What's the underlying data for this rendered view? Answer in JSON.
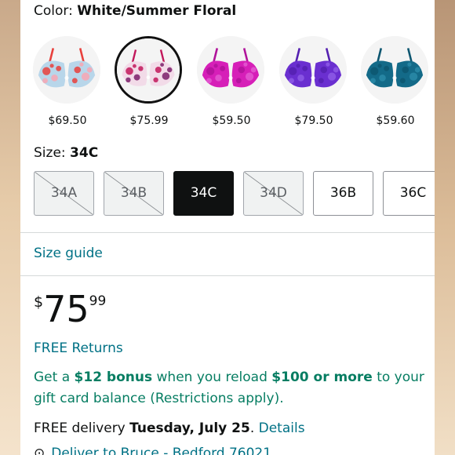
{
  "color": {
    "label": "Color:",
    "value": "White/Summer Floral"
  },
  "swatches": [
    {
      "price": "$69.50",
      "icon": "bra-light-blue-floral-icon",
      "cup": "#b8d6ea",
      "accent": "#e8403c",
      "accent2": "#f7a6b3",
      "selected": false
    },
    {
      "price": "$75.99",
      "icon": "bra-white-summer-floral-icon",
      "cup": "#f2dbe8",
      "accent": "#c2185b",
      "accent2": "#7b1f6a",
      "selected": true
    },
    {
      "price": "$59.50",
      "icon": "bra-magenta-icon",
      "cup": "#d61fb8",
      "accent": "#b0139a",
      "accent2": "#e35bd0",
      "selected": false
    },
    {
      "price": "$79.50",
      "icon": "bra-purple-lace-icon",
      "cup": "#6a2fd0",
      "accent": "#5420b0",
      "accent2": "#8d5be6",
      "selected": false
    },
    {
      "price": "$59.60",
      "icon": "bra-teal-lace-icon",
      "cup": "#136a88",
      "accent": "#0d5670",
      "accent2": "#2a8aa8",
      "selected": false
    }
  ],
  "size": {
    "label": "Size:",
    "value": "34C"
  },
  "sizes": [
    {
      "label": "34A",
      "state": "unavailable"
    },
    {
      "label": "34B",
      "state": "unavailable"
    },
    {
      "label": "34C",
      "state": "selected"
    },
    {
      "label": "34D",
      "state": "unavailable"
    },
    {
      "label": "36B",
      "state": "available"
    },
    {
      "label": "36C",
      "state": "available"
    }
  ],
  "size_guide": "Size guide",
  "price": {
    "symbol": "$",
    "whole": "75",
    "fraction": "99"
  },
  "free_returns": "FREE Returns",
  "bonus": {
    "p1": "Get a ",
    "b1": "$12 bonus",
    "p2": " when you reload ",
    "b2": "$100 or more",
    "p3": " to your gift card balance (Restrictions apply)."
  },
  "delivery": {
    "prefix": "FREE delivery ",
    "date": "Tuesday, July 25",
    "suffix": ". ",
    "details": "Details"
  },
  "deliver_to": "Deliver to Bruce - Bedford 76021",
  "colors": {
    "link": "#007185",
    "promo": "#067d62",
    "text": "#0f1111",
    "selected": "#0f1111"
  }
}
